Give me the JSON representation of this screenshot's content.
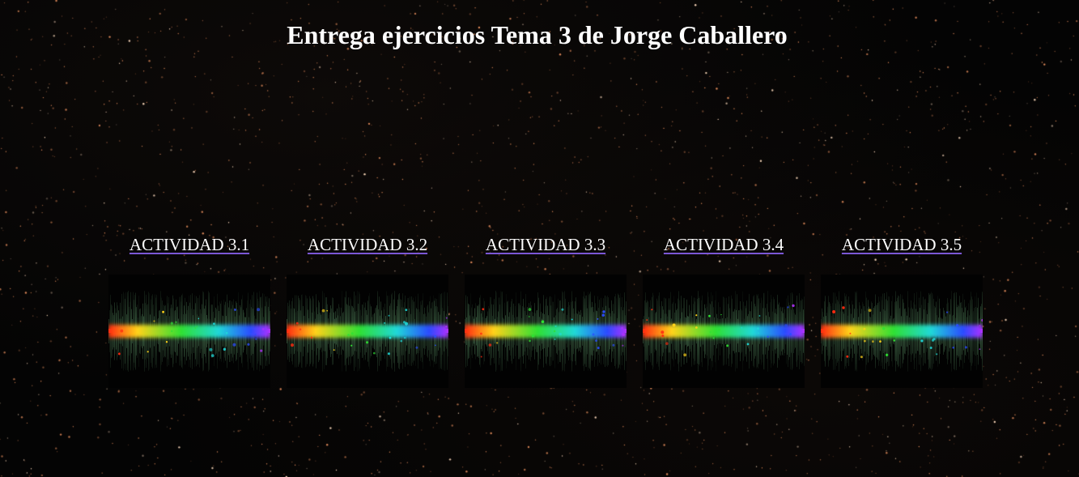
{
  "page": {
    "title": "Entrega ejercicios Tema 3 de Jorge Caballero"
  },
  "activities": [
    {
      "label": "ACTIVIDAD 3.1"
    },
    {
      "label": "ACTIVIDAD 3.2"
    },
    {
      "label": "ACTIVIDAD 3.3"
    },
    {
      "label": "ACTIVIDAD 3.4"
    },
    {
      "label": "ACTIVIDAD 3.5"
    }
  ],
  "colors": {
    "background": "#040404",
    "text": "#ffffff",
    "link_underline": "#7b57d6",
    "star": "#e08a5a",
    "spectrum": [
      "#ff2a10",
      "#ffd21a",
      "#2fe033",
      "#1fd8d8",
      "#2a4bff",
      "#b030ff"
    ]
  },
  "icons": {
    "activity_image": "rainbow-spectrum-image"
  }
}
